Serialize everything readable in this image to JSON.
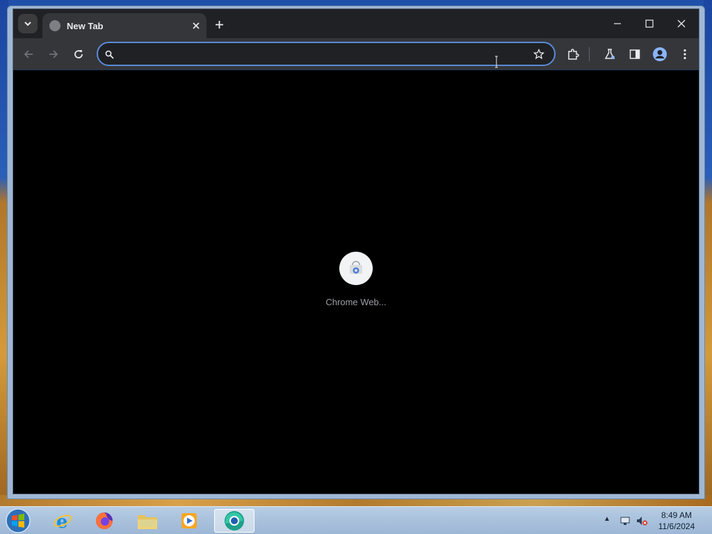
{
  "browser": {
    "tab": {
      "title": "New Tab"
    },
    "omnibox": {
      "value": "",
      "placeholder": ""
    },
    "shortcuts": [
      {
        "label": "Chrome Web..."
      }
    ]
  },
  "taskbar": {
    "apps": [
      {
        "name": "internet-explorer"
      },
      {
        "name": "firefox"
      },
      {
        "name": "file-explorer"
      },
      {
        "name": "media-player"
      },
      {
        "name": "chrome",
        "active": true
      }
    ],
    "clock": {
      "time": "8:49 AM",
      "date": "11/6/2024"
    }
  },
  "colors": {
    "tabstrip": "#202124",
    "toolbar": "#35363a",
    "omnibox_border": "#5b8bd8",
    "content": "#000000"
  }
}
